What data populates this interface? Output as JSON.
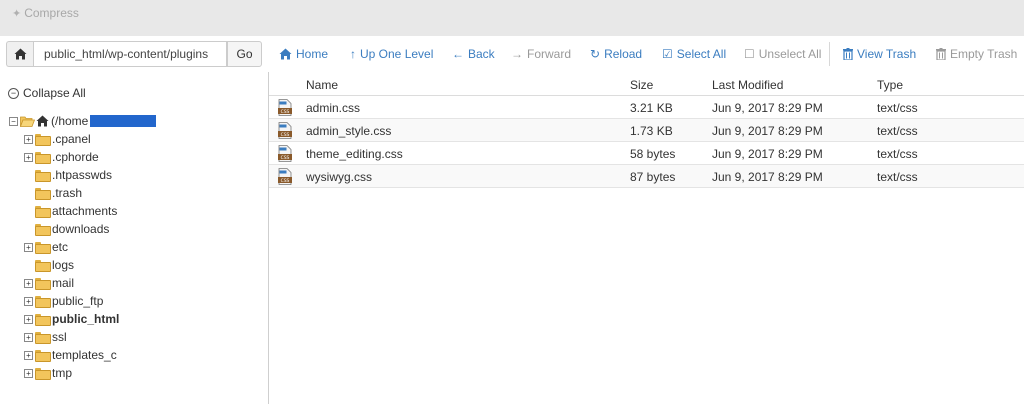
{
  "topbar": {
    "compress_label": "Compress"
  },
  "toolbar": {
    "path_value": "public_html/wp-content/plugins",
    "go_label": "Go",
    "items": [
      {
        "label": "Home",
        "icon": "home-icon",
        "enabled": true
      },
      {
        "label": "Up One Level",
        "icon": "up-arrow-icon",
        "enabled": true
      },
      {
        "label": "Back",
        "icon": "back-arrow-icon",
        "enabled": true
      },
      {
        "label": "Forward",
        "icon": "forward-arrow-icon",
        "enabled": false
      },
      {
        "label": "Reload",
        "icon": "reload-icon",
        "enabled": true
      },
      {
        "label": "Select All",
        "icon": "checkbox-checked-icon",
        "enabled": true
      },
      {
        "label": "Unselect All",
        "icon": "checkbox-empty-icon",
        "enabled": false
      },
      {
        "label": "View Trash",
        "icon": "trash-icon",
        "enabled": true
      },
      {
        "label": "Empty Trash",
        "icon": "trash-icon",
        "enabled": false
      }
    ]
  },
  "sidebar": {
    "collapse_label": "Collapse All",
    "root_label": "(/home",
    "items": [
      {
        "label": ".cpanel",
        "expandable": true,
        "bold": false
      },
      {
        "label": ".cphorde",
        "expandable": true,
        "bold": false
      },
      {
        "label": ".htpasswds",
        "expandable": false,
        "bold": false
      },
      {
        "label": ".trash",
        "expandable": false,
        "bold": false
      },
      {
        "label": "attachments",
        "expandable": false,
        "bold": false
      },
      {
        "label": "downloads",
        "expandable": false,
        "bold": false
      },
      {
        "label": "etc",
        "expandable": true,
        "bold": false
      },
      {
        "label": "logs",
        "expandable": false,
        "bold": false
      },
      {
        "label": "mail",
        "expandable": true,
        "bold": false
      },
      {
        "label": "public_ftp",
        "expandable": true,
        "bold": false
      },
      {
        "label": "public_html",
        "expandable": true,
        "bold": true
      },
      {
        "label": "ssl",
        "expandable": true,
        "bold": false
      },
      {
        "label": "templates_c",
        "expandable": true,
        "bold": false
      },
      {
        "label": "tmp",
        "expandable": true,
        "bold": false
      }
    ]
  },
  "table": {
    "headers": {
      "name": "Name",
      "size": "Size",
      "modified": "Last Modified",
      "type": "Type"
    },
    "rows": [
      {
        "name": "admin.css",
        "size": "3.21 KB",
        "modified": "Jun 9, 2017 8:29 PM",
        "type": "text/css"
      },
      {
        "name": "admin_style.css",
        "size": "1.73 KB",
        "modified": "Jun 9, 2017 8:29 PM",
        "type": "text/css"
      },
      {
        "name": "theme_editing.css",
        "size": "58 bytes",
        "modified": "Jun 9, 2017 8:29 PM",
        "type": "text/css"
      },
      {
        "name": "wysiwyg.css",
        "size": "87 bytes",
        "modified": "Jun 9, 2017 8:29 PM",
        "type": "text/css"
      }
    ]
  },
  "colors": {
    "accent": "#3b7dc0",
    "disabled": "#9a9a9a",
    "redaction": "#2266cc",
    "folder": "#f2c55c"
  }
}
